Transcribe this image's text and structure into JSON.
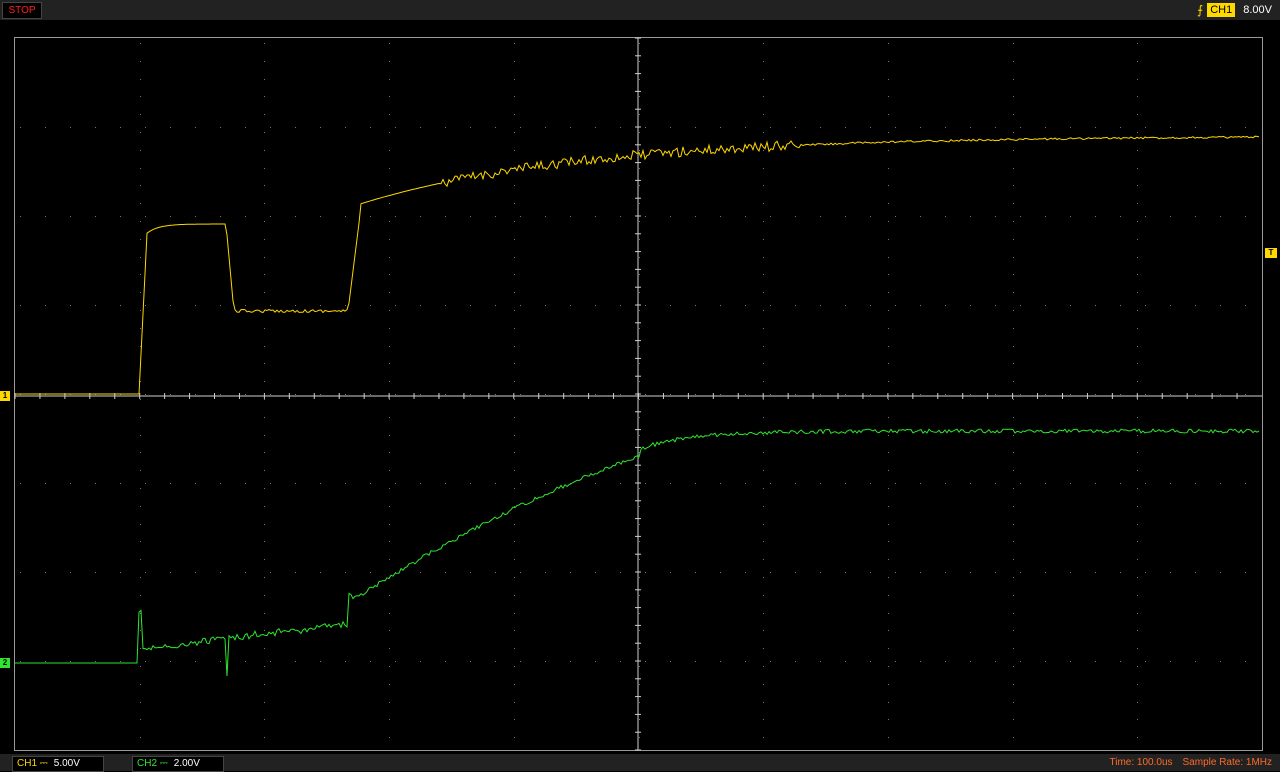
{
  "toolbar": {
    "stop_label": "STOP"
  },
  "trigger": {
    "channel": "CH1",
    "level": "8.00V",
    "edge_icon": "rising-edge-icon"
  },
  "channels": {
    "ch1": {
      "label": "CH1 ⎓",
      "scale": "5.00V",
      "marker": "1",
      "color": "#ffd800"
    },
    "ch2": {
      "label": "CH2 ⎓",
      "scale": "2.00V",
      "marker": "2",
      "color": "#2ee62e"
    }
  },
  "trigger_marker": "T",
  "status": {
    "time": "Time: 100.0us",
    "sample_rate": "Sample Rate: 1MHz"
  }
}
